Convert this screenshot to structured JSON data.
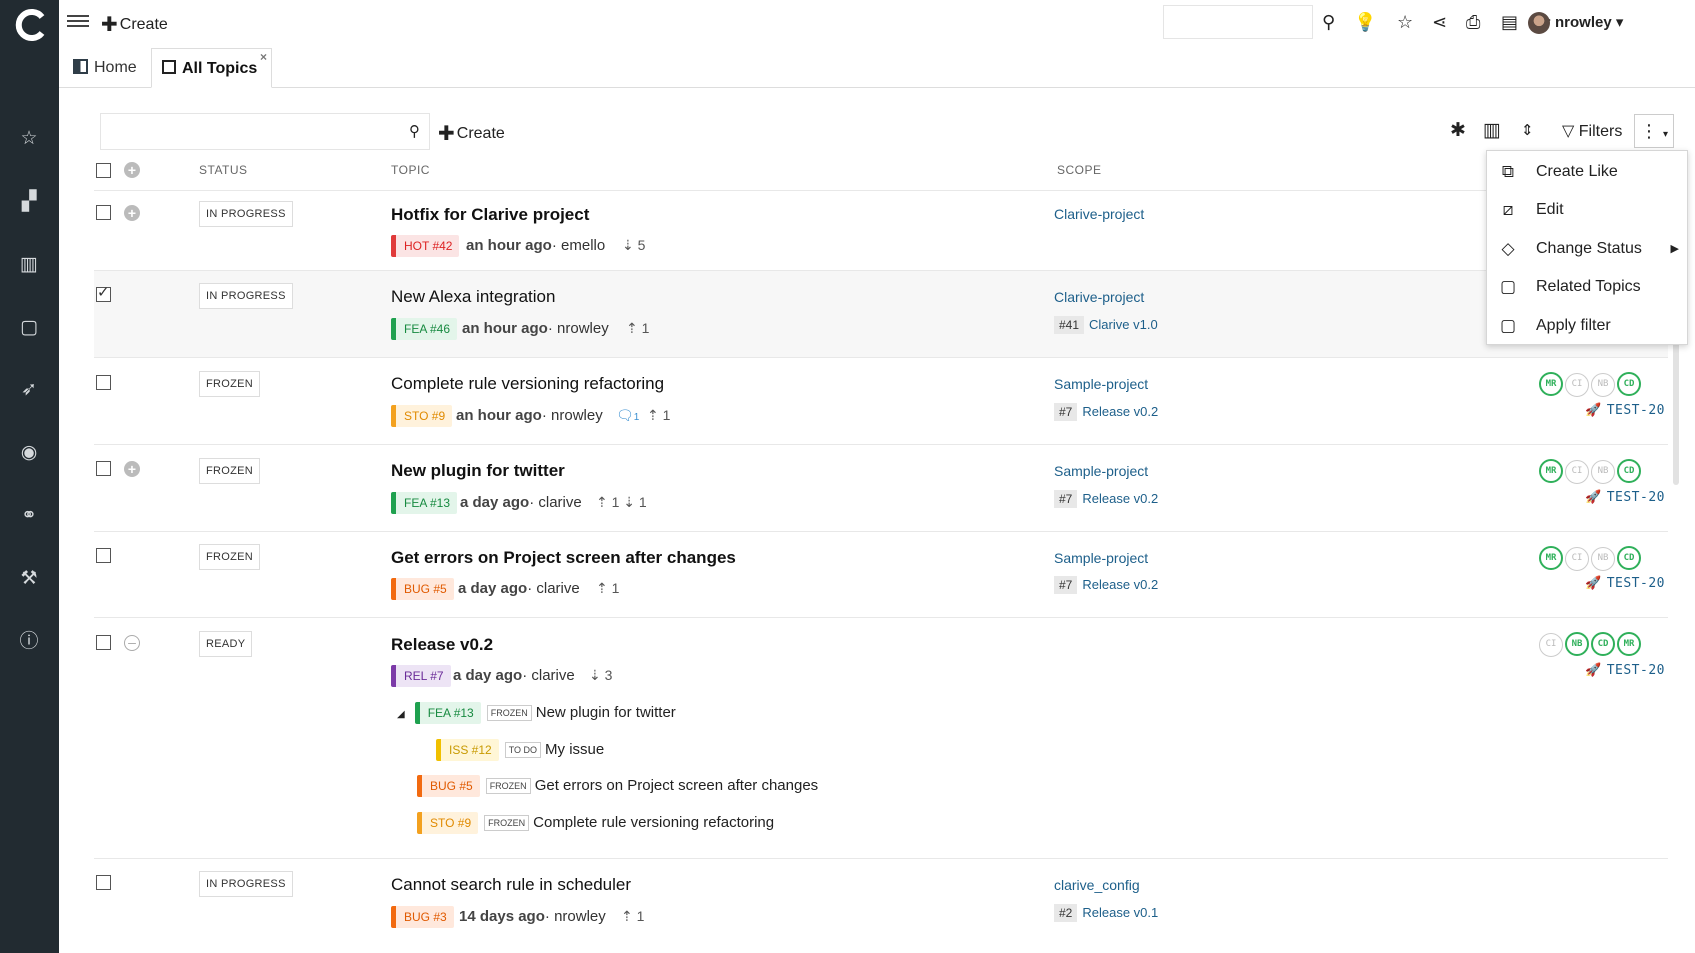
{
  "topbar": {
    "create_label": "Create",
    "search_value": "",
    "user_name": "nrowley"
  },
  "tabs": [
    {
      "label": "Home"
    },
    {
      "label": "All Topics",
      "close": "×"
    }
  ],
  "toolbar": {
    "search_value": "",
    "create_label": "Create",
    "filters_label": "Filters"
  },
  "columns": {
    "status": "STATUS",
    "topic": "TOPIC",
    "scope": "SCOPE"
  },
  "rows": [
    {
      "status": "IN PROGRESS",
      "title": "Hotfix for Clarive project",
      "tag": "HOT #42",
      "time": "an hour ago",
      "user": "emello",
      "counts": "⇣ 5",
      "scope": "Clarive-project",
      "release_id": "",
      "release": ""
    },
    {
      "status": "IN PROGRESS",
      "title": "New Alexa integration",
      "tag": "FEA #46",
      "time": "an hour ago",
      "user": "nrowley",
      "counts": "⇡ 1",
      "scope": "Clarive-project",
      "release_id": "#41",
      "release": "Clarive v1.0"
    },
    {
      "status": "FROZEN",
      "title": "Complete rule versioning refactoring",
      "tag": "STO #9",
      "time": "an hour ago",
      "user": "nrowley",
      "comments": "1",
      "counts": "⇡ 1",
      "scope": "Sample-project",
      "release_id": "#7",
      "release": "Release v0.2",
      "ci": [
        "MR",
        "CI",
        "NB",
        "CD"
      ],
      "test": "TEST-20"
    },
    {
      "status": "FROZEN",
      "title": "New plugin for twitter",
      "tag": "FEA #13",
      "time": "a day ago",
      "user": "clarive",
      "counts": "⇡ 1 ⇣ 1",
      "scope": "Sample-project",
      "release_id": "#7",
      "release": "Release v0.2",
      "ci": [
        "MR",
        "CI",
        "NB",
        "CD"
      ],
      "test": "TEST-20"
    },
    {
      "status": "FROZEN",
      "title": "Get errors on Project screen after changes",
      "tag": "BUG #5",
      "time": "a day ago",
      "user": "clarive",
      "counts": "⇡ 1",
      "scope": "Sample-project",
      "release_id": "#7",
      "release": "Release v0.2",
      "ci": [
        "MR",
        "CI",
        "NB",
        "CD"
      ],
      "test": "TEST-20"
    },
    {
      "status": "READY",
      "title": "Release v0.2",
      "tag": "REL #7",
      "time": "a day ago",
      "user": "clarive",
      "counts": "⇣ 3",
      "scope": "",
      "release_id": "",
      "release": "",
      "ci": [
        "CI",
        "NB",
        "CD",
        "MR"
      ],
      "test": "TEST-20",
      "children": [
        {
          "tag": "FEA #13",
          "state": "FROZEN",
          "title": "New plugin for twitter"
        },
        {
          "tag": "ISS #12",
          "state": "TO DO",
          "title": "My issue"
        },
        {
          "tag": "BUG #5",
          "state": "FROZEN",
          "title": "Get errors on Project screen after changes"
        },
        {
          "tag": "STO #9",
          "state": "FROZEN",
          "title": "Complete rule versioning refactoring"
        }
      ]
    },
    {
      "status": "IN PROGRESS",
      "title": "Cannot search rule in scheduler",
      "tag": "BUG #3",
      "time": "14 days ago",
      "user": "nrowley",
      "counts": "⇡ 1",
      "scope": "clarive_config",
      "release_id": "#2",
      "release": "Release v0.1"
    }
  ],
  "menu": {
    "items": [
      "Create Like",
      "Edit",
      "Change Status",
      "Related Topics",
      "Apply filter"
    ]
  }
}
